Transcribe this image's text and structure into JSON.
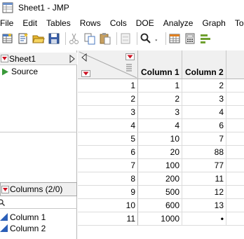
{
  "window": {
    "title": "Sheet1 - JMP"
  },
  "menu": [
    "File",
    "Edit",
    "Tables",
    "Rows",
    "Cols",
    "DOE",
    "Analyze",
    "Graph",
    "Too"
  ],
  "toolbar": {
    "icons": [
      "new-table-icon",
      "new-script-icon",
      "open-icon",
      "save-icon",
      "cut-icon",
      "copy-icon",
      "paste-icon",
      "journal-icon",
      "search-icon",
      "more-dropdown-icon",
      "data-table-icon",
      "calculator-icon",
      "distribution-icon"
    ]
  },
  "table_panel": {
    "title": "Sheet1",
    "source_label": "Source"
  },
  "columns_panel": {
    "title": "Columns (2/0)",
    "search_glyph": "🔍",
    "items": [
      "Column 1",
      "Column 2"
    ]
  },
  "grid": {
    "headers": [
      "Column 1",
      "Column 2"
    ],
    "rows": [
      {
        "n": "1",
        "c1": "1",
        "c2": "2"
      },
      {
        "n": "2",
        "c1": "2",
        "c2": "3"
      },
      {
        "n": "3",
        "c1": "3",
        "c2": "4"
      },
      {
        "n": "4",
        "c1": "4",
        "c2": "6"
      },
      {
        "n": "5",
        "c1": "10",
        "c2": "7"
      },
      {
        "n": "6",
        "c1": "20",
        "c2": "88"
      },
      {
        "n": "7",
        "c1": "100",
        "c2": "77"
      },
      {
        "n": "8",
        "c1": "200",
        "c2": "11"
      },
      {
        "n": "9",
        "c1": "500",
        "c2": "12"
      },
      {
        "n": "10",
        "c1": "600",
        "c2": "13"
      },
      {
        "n": "11",
        "c1": "1000",
        "c2": "•"
      }
    ]
  },
  "colors": {
    "hotspot_red": "#cc1122",
    "source_green": "#3a9a3a",
    "continuous_blue": "#2b5fb8"
  }
}
